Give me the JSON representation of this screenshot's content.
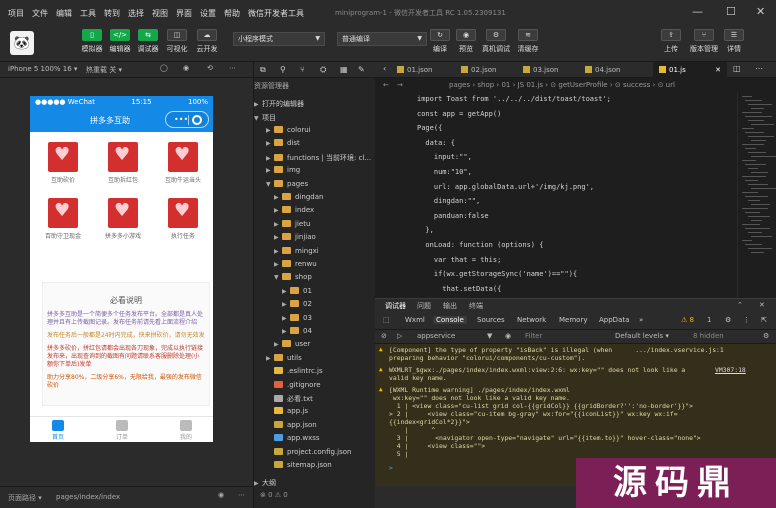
{
  "menu": [
    "项目",
    "文件",
    "编辑",
    "工具",
    "转到",
    "选择",
    "视图",
    "界面",
    "设置",
    "帮助",
    "微信开发者工具"
  ],
  "window_title": "miniprogram-1 - 微信开发者工具 RC 1.05.2309131",
  "window_controls": [
    "—",
    "☐",
    "✕"
  ],
  "toolbar": {
    "avatar_glyph": "🐼",
    "left_buttons": [
      {
        "label": "模拟器",
        "glyph": "▯",
        "active": true
      },
      {
        "label": "编辑器",
        "glyph": "</>",
        "active": true
      },
      {
        "label": "调试器",
        "glyph": "⇆",
        "active": true
      },
      {
        "label": "可视化",
        "glyph": "◫",
        "active": false
      },
      {
        "label": "云开发",
        "glyph": "☁",
        "active": false
      }
    ],
    "mode_select": "小程序模式",
    "compile_select": "普通编译",
    "right_buttons": [
      {
        "label": "编译",
        "glyph": "↻"
      },
      {
        "label": "预览",
        "glyph": "◉"
      },
      {
        "label": "真机调试",
        "glyph": "⚙"
      },
      {
        "label": "清缓存",
        "glyph": "≋"
      }
    ],
    "far_buttons": [
      {
        "label": "上传",
        "glyph": "⇪"
      },
      {
        "label": "版本管理",
        "glyph": "⑂"
      },
      {
        "label": "详情",
        "glyph": "☰"
      }
    ]
  },
  "simulator": {
    "device": "iPhone 5 100% 16 ▾",
    "hotreload": "热重载 关 ▾",
    "status_left": "●●●●● WeChat",
    "status_time": "15:15",
    "status_right": "100%",
    "nav_title": "拼多多互助",
    "capsule_dots": "•••",
    "grid": [
      {
        "label": "互助砍价"
      },
      {
        "label": "互助拆红包"
      },
      {
        "label": "互助牛运当头"
      },
      {
        "label": "百助守卫现金"
      },
      {
        "label": "拼多多小游戏"
      },
      {
        "label": "执行任务"
      }
    ],
    "note_title": "必看说明",
    "note_paragraphs": [
      "拼多多互助是一个简便多个任务发布平台。全部都是真人处理并且有上传截图记录。发布任务前请先看上面流程介绍",
      "发布任务后一般都是24时内完成，快来拼砍价，请勿无效发",
      "拼多多砍价，拼红包请都会出现各刀现象，完成以执行链接发布来，出现查询到的截图有问题请联系客服删除处理(小额你下单后)发单",
      "助力分享80%，二级分享6%，无限给我，最强的发布微信砍价"
    ],
    "tabs": [
      {
        "label": "首页",
        "active": true
      },
      {
        "label": "订单",
        "active": false
      },
      {
        "label": "我的",
        "active": false
      }
    ],
    "footer_path_label": "页面路径 ▾",
    "footer_path": "pages/index/index"
  },
  "explorer": {
    "title": "资源管理器",
    "open_editors": "打开的编辑器",
    "project": "项目",
    "rows": [
      {
        "name": "colorui",
        "type": "folder",
        "depth": 1,
        "open": false
      },
      {
        "name": "dist",
        "type": "folder",
        "depth": 1,
        "open": false
      },
      {
        "name": "functions | 当前环境: cl...",
        "type": "folder",
        "depth": 1,
        "open": false
      },
      {
        "name": "img",
        "type": "folder",
        "depth": 1,
        "open": false
      },
      {
        "name": "pages",
        "type": "folder",
        "depth": 1,
        "open": true
      },
      {
        "name": "dingdan",
        "type": "folder",
        "depth": 2,
        "open": false
      },
      {
        "name": "index",
        "type": "folder",
        "depth": 2,
        "open": false
      },
      {
        "name": "jietu",
        "type": "folder",
        "depth": 2,
        "open": false
      },
      {
        "name": "jinjiao",
        "type": "folder",
        "depth": 2,
        "open": false
      },
      {
        "name": "mingxi",
        "type": "folder",
        "depth": 2,
        "open": false
      },
      {
        "name": "renwu",
        "type": "folder",
        "depth": 2,
        "open": false
      },
      {
        "name": "shop",
        "type": "folder",
        "depth": 2,
        "open": true
      },
      {
        "name": "01",
        "type": "folder",
        "depth": 3,
        "open": false
      },
      {
        "name": "02",
        "type": "folder",
        "depth": 3,
        "open": false
      },
      {
        "name": "03",
        "type": "folder",
        "depth": 3,
        "open": false
      },
      {
        "name": "04",
        "type": "folder",
        "depth": 3,
        "open": false
      },
      {
        "name": "user",
        "type": "folder",
        "depth": 2,
        "open": false
      },
      {
        "name": "utils",
        "type": "folder",
        "depth": 1,
        "open": false
      },
      {
        "name": ".eslintrc.js",
        "type": "js",
        "depth": 1
      },
      {
        "name": ".gitignore",
        "type": "git",
        "depth": 1
      },
      {
        "name": "必看.txt",
        "type": "txt",
        "depth": 1
      },
      {
        "name": "app.js",
        "type": "js",
        "depth": 1
      },
      {
        "name": "app.json",
        "type": "json",
        "depth": 1
      },
      {
        "name": "app.wxss",
        "type": "wxss",
        "depth": 1
      },
      {
        "name": "project.config.json",
        "type": "json",
        "depth": 1
      },
      {
        "name": "sitemap.json",
        "type": "json",
        "depth": 1
      }
    ],
    "outline": "大纲",
    "status": "⊗ 0 ⚠ 0"
  },
  "editor": {
    "tabs": [
      {
        "name": "01.json",
        "type": "json",
        "active": false
      },
      {
        "name": "02.json",
        "type": "json",
        "active": false
      },
      {
        "name": "03.json",
        "type": "json",
        "active": false
      },
      {
        "name": "04.json",
        "type": "json",
        "active": false
      },
      {
        "name": "01.js",
        "type": "js",
        "active": true
      }
    ],
    "breadcrumb": "pages › shop › 01 › JS 01.js › ⊙ getUserProfile › ⊙ success › ⊙ url",
    "lines": [
      "import Toast from '../../../dist/toast/toast';",
      "const app = getApp()",
      "Page({",
      "  data: {",
      "    input:\"\",",
      "    num:\"10\",",
      "    url: app.globalData.url+'/img/kj.png',",
      "    dingdan:\"\",",
      "    panduan:false",
      "  },",
      "  onLoad: function (options) {",
      "    var that = this;",
      "    if(wx.getStorageSync('name')==\"\"){",
      "      that.setData({"
    ]
  },
  "devtools": {
    "top_tabs": [
      "调试器",
      "问题",
      "输出",
      "终端"
    ],
    "sub_tabs": [
      {
        "label": "Wxml",
        "active": false
      },
      {
        "label": "Console",
        "active": true
      },
      {
        "label": "Sources",
        "active": false
      },
      {
        "label": "Network",
        "active": false
      },
      {
        "label": "Memory",
        "active": false
      },
      {
        "label": "AppData",
        "active": false
      }
    ],
    "warn_count": "⚠ 8",
    "err_count": "1",
    "context": "appservice",
    "filter_placeholder": "Filter",
    "levels": "Default levels ▾",
    "hidden": "8 hidden",
    "console_lines": [
      "[Component] the type of property \"isBack\" is illegal (when      .../index.vservice.js:1",
      "preparing behavior \"colorui/components/cu-custom\").",
      "WXMLRT_$gwx:./pages/index/index.wxml:view:2:6: wx:key=\"\" does not look like a",
      "valid key name.",
      "[WXML Runtime warning] ./pages/index/index.wxml",
      " wx:key=\"\" does not look like a valid key name.",
      "  1 | <view class=\"cu-list grid col-{{gridCol}} {{gridBorder?'':'no-border'}}\">",
      "> 2 |     <view class=\"cu-item bg-gray\" wx:for=\"{{iconList}}\" wx:key wx:if=",
      "{{index<gridCol*2}}\">",
      "    |      ^",
      "  3 |       <navigator open-type=\"navigate\" url=\"{{item.to}}\" hover-class=\"none\">",
      "  4 |     <view class=\"\">",
      "  5 |"
    ],
    "vm_link": "VM307:18",
    "prompt": ">"
  },
  "watermark": "源码鼎"
}
